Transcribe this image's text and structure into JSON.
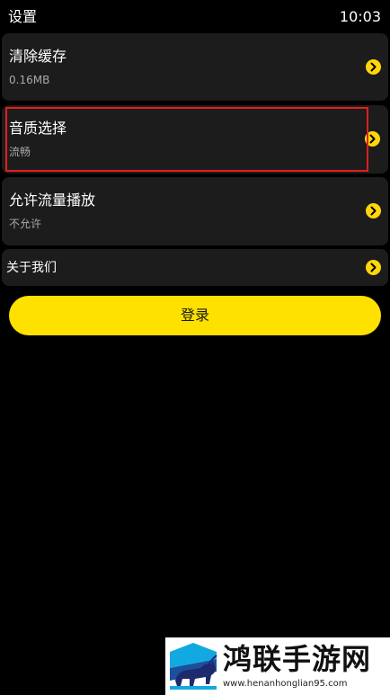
{
  "status_bar": {
    "title": "设置",
    "time": "10:03"
  },
  "settings": [
    {
      "title": "清除缓存",
      "subtitle": "0.16MB",
      "icon": "chevron-right-circle-icon"
    },
    {
      "title": "音质选择",
      "subtitle": "流畅",
      "icon": "chevron-right-circle-icon",
      "highlighted": true
    },
    {
      "title": "允许流量播放",
      "subtitle": "不允许",
      "icon": "chevron-right-circle-icon"
    },
    {
      "title": "关于我们",
      "icon": "chevron-right-circle-icon"
    }
  ],
  "login_button": {
    "label": "登录"
  },
  "watermark": {
    "brand": "鸿联手游网",
    "url": "www.henanhonglian95.com"
  },
  "colors": {
    "background": "#000000",
    "card": "#1c1c1c",
    "accent": "#ffe100",
    "highlight_border": "#e0201e",
    "subtitle": "#a8a8a8"
  }
}
